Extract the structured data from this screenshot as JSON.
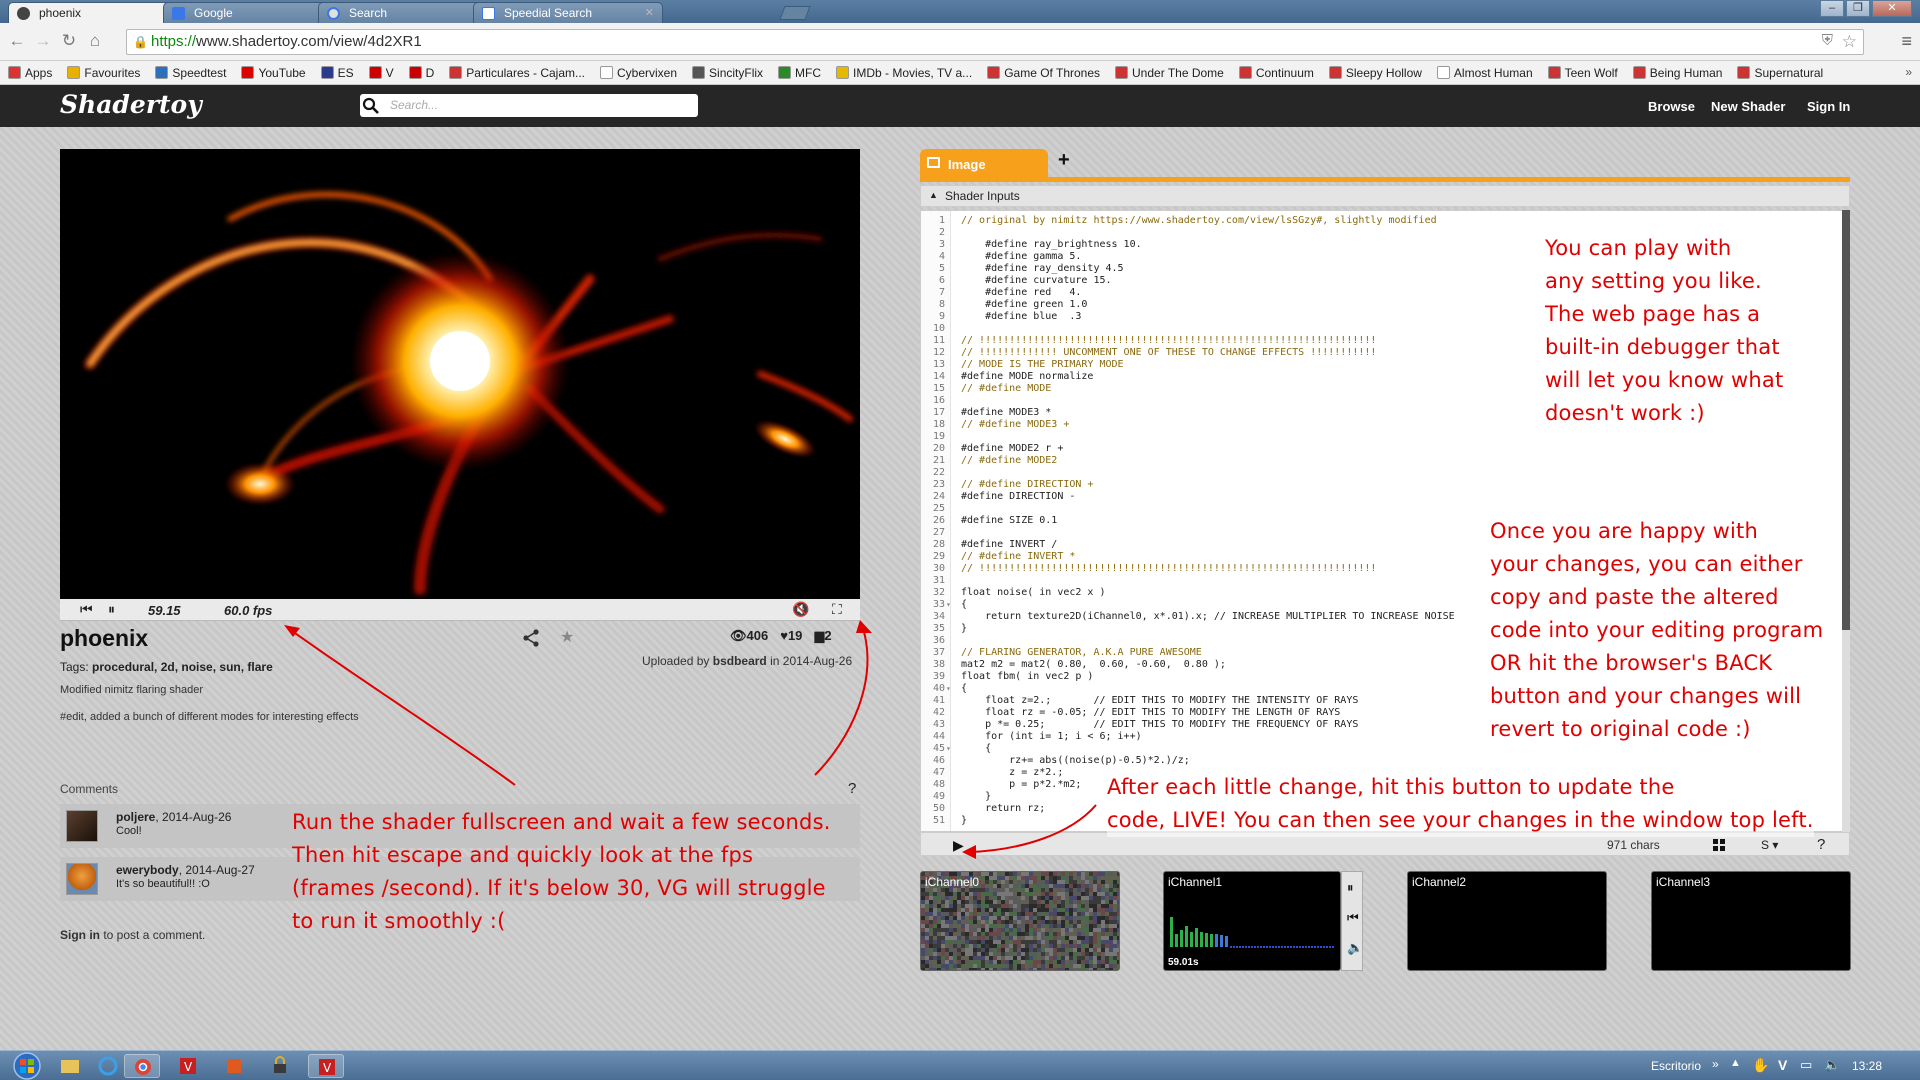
{
  "browser": {
    "tabs": [
      {
        "label": "phoenix",
        "icon": "shadertoy-favicon"
      },
      {
        "label": "Google",
        "icon": "google-favicon"
      },
      {
        "label": "Search",
        "icon": "search-favicon"
      },
      {
        "label": "Speedial Search",
        "icon": "speeddial-favicon"
      }
    ],
    "url_scheme": "https://",
    "url_rest": "www.shadertoy.com/view/4d2XR1",
    "bookmarks": [
      {
        "label": "Apps",
        "icon": "apps-icon",
        "color": "#d33"
      },
      {
        "label": "Favourites",
        "icon": "folder-icon",
        "color": "#e8b100"
      },
      {
        "label": "Speedtest",
        "icon": "speedtest-icon",
        "color": "#2d6fb8"
      },
      {
        "label": "YouTube",
        "icon": "youtube-icon",
        "color": "#d00"
      },
      {
        "label": "ES",
        "icon": "es-icon",
        "color": "#2a3a8c"
      },
      {
        "label": "V",
        "icon": "v-icon",
        "color": "#c00"
      },
      {
        "label": "D",
        "icon": "d-icon",
        "color": "#c00"
      },
      {
        "label": "Particulares - Cajam...",
        "icon": "bank-icon",
        "color": "#c33"
      },
      {
        "label": "Cybervixen",
        "icon": "page-icon",
        "color": "#fff"
      },
      {
        "label": "SincityFlix",
        "icon": "sincity-icon",
        "color": "#555"
      },
      {
        "label": "MFC",
        "icon": "mfc-icon",
        "color": "#2a8a2a"
      },
      {
        "label": "IMDb - Movies, TV a...",
        "icon": "imdb-icon",
        "color": "#e6b800"
      },
      {
        "label": "Game Of Thrones",
        "icon": "tv-icon",
        "color": "#c33"
      },
      {
        "label": "Under The Dome",
        "icon": "tv-icon",
        "color": "#c33"
      },
      {
        "label": "Continuum",
        "icon": "tv-icon",
        "color": "#c33"
      },
      {
        "label": "Sleepy Hollow",
        "icon": "tv-icon",
        "color": "#c33"
      },
      {
        "label": "Almost Human",
        "icon": "page-icon",
        "color": "#fff"
      },
      {
        "label": "Teen Wolf",
        "icon": "tv-icon",
        "color": "#c33"
      },
      {
        "label": "Being Human",
        "icon": "tv-icon",
        "color": "#c33"
      },
      {
        "label": "Supernatural",
        "icon": "tv-icon",
        "color": "#c33"
      }
    ]
  },
  "site": {
    "logo": "Shadertoy",
    "search_placeholder": "Search...",
    "nav": {
      "browse": "Browse",
      "new_shader": "New Shader",
      "sign_in": "Sign In"
    }
  },
  "player": {
    "time": "59.15",
    "fps": "60.0 fps"
  },
  "shader": {
    "title": "phoenix",
    "tags_label": "Tags:",
    "tags": "procedural, 2d, noise, sun, flare",
    "description": "Modified nimitz flaring shader",
    "edit_note": "#edit, added a bunch of different modes for interesting effects",
    "views": "406",
    "likes": "19",
    "comment_count": "2",
    "uploaded_prefix": "Uploaded by",
    "uploader": "bsdbeard",
    "uploaded_suffix": "in 2014-Aug-26"
  },
  "comments": {
    "label": "Comments",
    "help": "?",
    "items": [
      {
        "user": "poljere",
        "date": ", 2014-Aug-26",
        "text": "Cool!"
      },
      {
        "user": "ewerybody",
        "date": ", 2014-Aug-27",
        "text": "It's so beautiful!! :O"
      }
    ],
    "signin_link": "Sign in",
    "signin_suffix": " to post a comment."
  },
  "editor": {
    "tab_label": "Image",
    "add_tab": "+",
    "shader_inputs": "Shader Inputs",
    "chars": "971 chars",
    "font_size": "S",
    "help": "?",
    "code_lines": [
      {
        "n": "1",
        "t": "// original by nimitz https://www.shadertoy.com/view/lsSGzy#, slightly modified",
        "c": true
      },
      {
        "n": "2",
        "t": ""
      },
      {
        "n": "3",
        "t": "    #define ray_brightness 10."
      },
      {
        "n": "4",
        "t": "    #define gamma 5."
      },
      {
        "n": "5",
        "t": "    #define ray_density 4.5"
      },
      {
        "n": "6",
        "t": "    #define curvature 15."
      },
      {
        "n": "7",
        "t": "    #define red   4."
      },
      {
        "n": "8",
        "t": "    #define green 1.0"
      },
      {
        "n": "9",
        "t": "    #define blue  .3"
      },
      {
        "n": "10",
        "t": ""
      },
      {
        "n": "11",
        "t": "// !!!!!!!!!!!!!!!!!!!!!!!!!!!!!!!!!!!!!!!!!!!!!!!!!!!!!!!!!!!!!!!!!!",
        "c": true
      },
      {
        "n": "12",
        "t": "// !!!!!!!!!!!!! UNCOMMENT ONE OF THESE TO CHANGE EFFECTS !!!!!!!!!!!",
        "c": true
      },
      {
        "n": "13",
        "t": "// MODE IS THE PRIMARY MODE",
        "c": true
      },
      {
        "n": "14",
        "t": "#define MODE normalize"
      },
      {
        "n": "15",
        "t": "// #define MODE",
        "c": true
      },
      {
        "n": "16",
        "t": ""
      },
      {
        "n": "17",
        "t": "#define MODE3 *"
      },
      {
        "n": "18",
        "t": "// #define MODE3 +",
        "c": true
      },
      {
        "n": "19",
        "t": ""
      },
      {
        "n": "20",
        "t": "#define MODE2 r +"
      },
      {
        "n": "21",
        "t": "// #define MODE2",
        "c": true
      },
      {
        "n": "22",
        "t": ""
      },
      {
        "n": "23",
        "t": "// #define DIRECTION +",
        "c": true
      },
      {
        "n": "24",
        "t": "#define DIRECTION -"
      },
      {
        "n": "25",
        "t": ""
      },
      {
        "n": "26",
        "t": "#define SIZE 0.1"
      },
      {
        "n": "27",
        "t": ""
      },
      {
        "n": "28",
        "t": "#define INVERT /"
      },
      {
        "n": "29",
        "t": "// #define INVERT *",
        "c": true
      },
      {
        "n": "30",
        "t": "// !!!!!!!!!!!!!!!!!!!!!!!!!!!!!!!!!!!!!!!!!!!!!!!!!!!!!!!!!!!!!!!!!!",
        "c": true
      },
      {
        "n": "31",
        "t": ""
      },
      {
        "n": "32",
        "t": "float noise( in vec2 x )"
      },
      {
        "n": "33",
        "t": "{",
        "f": true
      },
      {
        "n": "34",
        "t": "    return texture2D(iChannel0, x*.01).x; // INCREASE MULTIPLIER TO INCREASE NOISE"
      },
      {
        "n": "35",
        "t": "}"
      },
      {
        "n": "36",
        "t": ""
      },
      {
        "n": "37",
        "t": "// FLARING GENERATOR, A.K.A PURE AWESOME",
        "c": true
      },
      {
        "n": "38",
        "t": "mat2 m2 = mat2( 0.80,  0.60, -0.60,  0.80 );"
      },
      {
        "n": "39",
        "t": "float fbm( in vec2 p )"
      },
      {
        "n": "40",
        "t": "{",
        "f": true
      },
      {
        "n": "41",
        "t": "    float z=2.;       // EDIT THIS TO MODIFY THE INTENSITY OF RAYS"
      },
      {
        "n": "42",
        "t": "    float rz = -0.05; // EDIT THIS TO MODIFY THE LENGTH OF RAYS"
      },
      {
        "n": "43",
        "t": "    p *= 0.25;        // EDIT THIS TO MODIFY THE FREQUENCY OF RAYS"
      },
      {
        "n": "44",
        "t": "    for (int i= 1; i < 6; i++)"
      },
      {
        "n": "45",
        "t": "    {",
        "f": true
      },
      {
        "n": "46",
        "t": "        rz+= abs((noise(p)-0.5)*2.)/z;"
      },
      {
        "n": "47",
        "t": "        z = z*2.;"
      },
      {
        "n": "48",
        "t": "        p = p*2.*m2;"
      },
      {
        "n": "49",
        "t": "    }"
      },
      {
        "n": "50",
        "t": "    return rz;"
      },
      {
        "n": "51",
        "t": "}"
      }
    ]
  },
  "channels": [
    {
      "label": "iChannel0"
    },
    {
      "label": "iChannel1",
      "time": "59.01s"
    },
    {
      "label": "iChannel2"
    },
    {
      "label": "iChannel3"
    }
  ],
  "annotations": {
    "top_right": [
      "You can play with",
      "any setting you like.",
      "The web page has a",
      "built-in debugger that",
      "will let you know what",
      "doesn't work :)"
    ],
    "mid_right": [
      "Once you are happy with",
      "your changes, you can either",
      "copy and paste the altered",
      "code into your editing program",
      "OR hit the browser's BACK",
      "button and your changes will",
      "revert to original code :)"
    ],
    "bottom_right": [
      "After each little change, hit this button to update the",
      "code, LIVE! You can then see your changes in the window top left."
    ],
    "bottom_left": [
      "Run the shader fullscreen and wait a few seconds.",
      "Then hit escape and quickly look at the fps",
      "(frames /second). If it's below 30, VG will struggle",
      "to run it smoothly :("
    ],
    "color": "#e00000"
  },
  "taskbar": {
    "tray_label": "Escritorio",
    "clock": "13:28"
  }
}
